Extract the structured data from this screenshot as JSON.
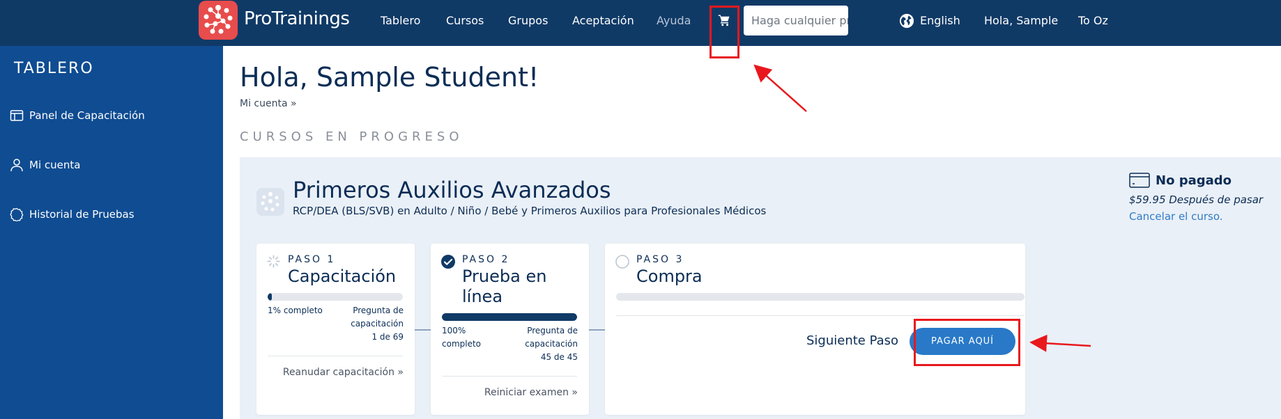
{
  "nav": {
    "brand": "ProTrainings",
    "links": [
      "Tablero",
      "Cursos",
      "Grupos",
      "Aceptación",
      "Ayuda"
    ],
    "search_placeholder": "Haga cualquier pregunta",
    "language": "English",
    "greeting": "Hola, Sample",
    "to_oz": "To Oz"
  },
  "sidebar": {
    "title": "TABLERO",
    "items": [
      {
        "label": "Panel de Capacitación",
        "icon": "panel-icon"
      },
      {
        "label": "Mi cuenta",
        "icon": "user-icon"
      },
      {
        "label": "Historial de Pruebas",
        "icon": "badge-icon"
      }
    ]
  },
  "main": {
    "greeting": "Hola, Sample Student!",
    "account_link": "Mi cuenta »",
    "section_title": "CURSOS EN PROGRESO"
  },
  "course": {
    "title": "Primeros Auxilios Avanzados",
    "subtitle": "RCP/DEA (BLS/SVB) en Adulto / Niño / Bebé y Primeros Auxilios para Profesionales Médicos",
    "payment_status": "No pagado",
    "price_note": "$59.95 Después de pasar",
    "cancel_link": "Cancelar el curso.",
    "steps": [
      {
        "label": "PASO 1",
        "name": "Capacitación",
        "progress": 1,
        "progress_text": "1% completo",
        "question_line1": "Pregunta de",
        "question_line2": "capacitación",
        "question_line3": "1 de 69",
        "action": "Reanudar capacitación  »"
      },
      {
        "label": "PASO 2",
        "name_line1": "Prueba en",
        "name_line2": "línea",
        "progress": 100,
        "progress_line1": "100%",
        "progress_line2": "completo",
        "question_line1": "Pregunta de",
        "question_line2": "capacitación",
        "question_line3": "45 de 45",
        "action": "Reiniciar examen  »"
      },
      {
        "label": "PASO 3",
        "name": "Compra",
        "progress": 0,
        "next_step": "Siguiente Paso",
        "pay_button": "PAGAR AQUÍ"
      }
    ]
  },
  "colors": {
    "nav_bg": "#103a66",
    "sidebar_bg": "#0f4c92",
    "accent": "#2979c8",
    "annotation": "#e8181d",
    "logo": "#e84c4c"
  }
}
